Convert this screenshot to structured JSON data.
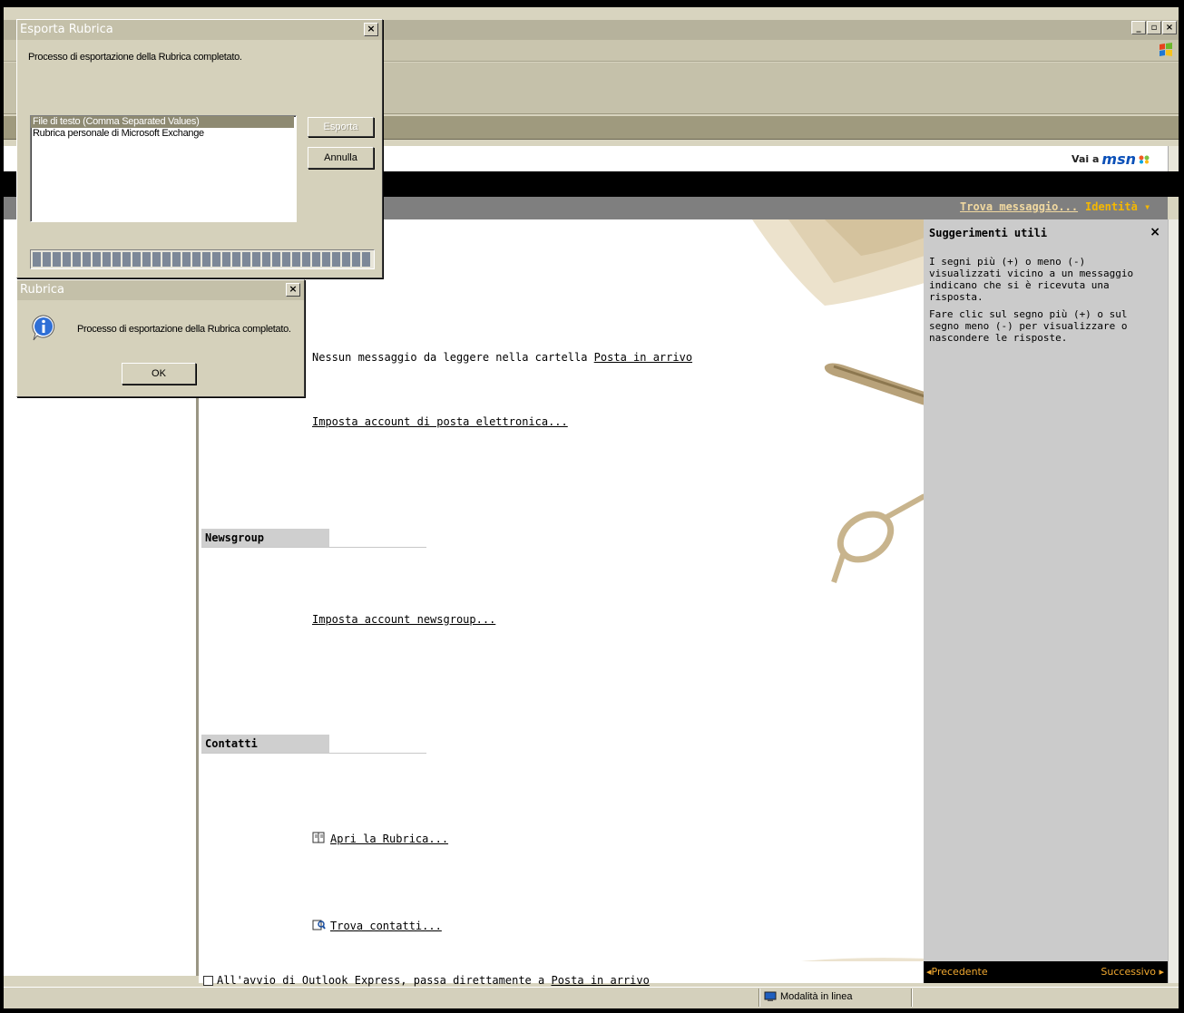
{
  "main_window": {
    "minimize": "_",
    "maximize": "▫",
    "close": "×"
  },
  "msn_bar": {
    "prefix": "Vai a",
    "brand": "msn"
  },
  "header": {
    "find_message": "Trova messaggio...",
    "identities": "Identità ▾"
  },
  "content": {
    "no_unread_text": "Nessun messaggio da leggere nella cartella ",
    "inbox_link": "Posta in arrivo",
    "setup_mail_account": "Imposta account di posta elettronica...",
    "newsgroup_header": "Newsgroup",
    "setup_news_account": "Imposta account newsgroup...",
    "contacts_header": "Contatti",
    "open_address_book": "Apri la Rubrica...",
    "find_contacts": "Trova contatti...",
    "startup_checkbox_label_pre": "All'avvio di Outlook Express, passa direttamente a ",
    "startup_checkbox_label_link": "Posta in arrivo",
    "startup_checked": false
  },
  "tips": {
    "title": "Suggerimenti utili",
    "close": "×",
    "paragraph1": "I segni più (+) o meno (-) visualizzati vicino a un messaggio indicano che si è ricevuta una risposta.",
    "paragraph2": "Fare clic sul segno più (+) o sul segno meno (-) per visualizzare o nascondere le risposte.",
    "prev": "◂Precedente",
    "next": "Successivo ▸"
  },
  "status_bar": {
    "online_mode": "Modalità in linea"
  },
  "export_dialog": {
    "title": "Esporta Rubrica",
    "close": "×",
    "message": "Processo di esportazione della Rubrica completato.",
    "formats": [
      "File di testo (Comma Separated Values)",
      "Rubrica personale di Microsoft Exchange"
    ],
    "selected_format_index": 0,
    "export_button": "Esporta",
    "cancel_button": "Annulla",
    "progress": 1.0
  },
  "info_dialog": {
    "title": "Rubrica",
    "close": "×",
    "message": "Processo di esportazione della Rubrica completato.",
    "ok_button": "OK"
  },
  "colors": {
    "chrome": "#d5d1bb",
    "tips_pane": "#cbcbcb",
    "accent_orange": "#f5b800",
    "selection": "#8e8a72"
  }
}
